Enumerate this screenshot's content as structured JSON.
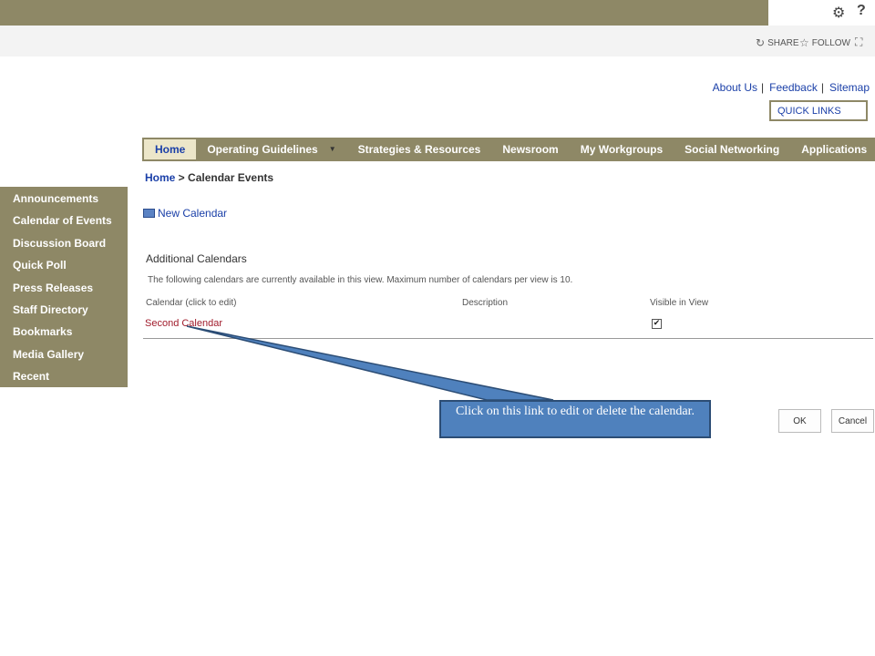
{
  "suite_bar": {
    "settings_icon": "gear-icon",
    "help_label": "?"
  },
  "ribbon": {
    "share_label": "SHARE",
    "follow_label": "FOLLOW",
    "focus_icon": "focus-icon"
  },
  "header_links": {
    "about": "About Us",
    "feedback": "Feedback",
    "sitemap": "Sitemap",
    "separator": "|",
    "quick_links": "QUICK LINKS"
  },
  "top_nav": {
    "items": [
      {
        "label": "Home",
        "active": true,
        "dropdown": false
      },
      {
        "label": "Operating Guidelines",
        "active": false,
        "dropdown": true
      },
      {
        "label": "Strategies & Resources",
        "active": false,
        "dropdown": false
      },
      {
        "label": "Newsroom",
        "active": false,
        "dropdown": false
      },
      {
        "label": "My Workgroups",
        "active": false,
        "dropdown": false
      },
      {
        "label": "Social Networking",
        "active": false,
        "dropdown": false
      },
      {
        "label": "Applications",
        "active": false,
        "dropdown": true
      }
    ],
    "dropdown_glyph": "▼"
  },
  "breadcrumb": {
    "root": "Home",
    "separator": " > ",
    "current": "Calendar Events"
  },
  "sidebar": {
    "items": [
      {
        "label": "Announcements"
      },
      {
        "label": "Calendar of Events"
      },
      {
        "label": "Discussion Board"
      },
      {
        "label": "Quick Poll"
      },
      {
        "label": "Press Releases"
      },
      {
        "label": "Staff Directory"
      },
      {
        "label": "Bookmarks"
      },
      {
        "label": "Media Gallery"
      },
      {
        "label": "Recent"
      }
    ]
  },
  "main": {
    "new_calendar_label": "New Calendar",
    "section_title": "Additional Calendars",
    "section_description": "The following calendars are currently available in this view. Maximum number of calendars per view is 10.",
    "columns": {
      "calendar": "Calendar (click to edit)",
      "description": "Description",
      "visible": "Visible in View"
    },
    "rows": [
      {
        "calendar": "Second Calendar",
        "description": "",
        "visible": true
      }
    ],
    "ok_label": "OK",
    "cancel_label": "Cancel"
  },
  "callout": {
    "text": "Click on this link to edit or delete the calendar."
  },
  "colors": {
    "brand": "#8e8866",
    "nav_active_bg": "#ece6c9",
    "link": "#1a3fa8",
    "calendar_link": "#a01b2b",
    "callout_fill": "#4f81bd"
  }
}
